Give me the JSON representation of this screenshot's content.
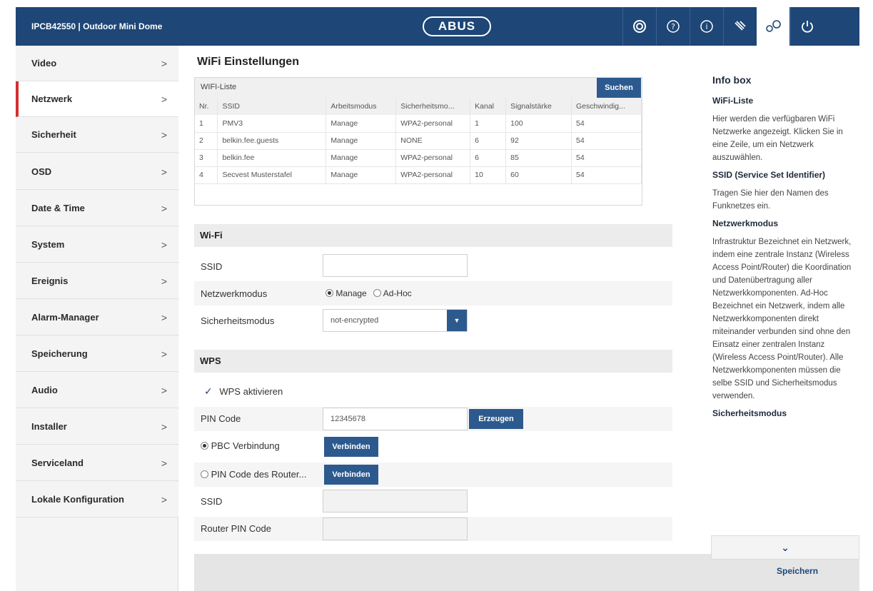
{
  "header": {
    "brand": "IPCB42550 | Outdoor Mini Dome",
    "logo": "ABUS",
    "icons": [
      "camera-icon",
      "help-icon",
      "info-icon",
      "tools-icon",
      "settings-icon",
      "power-icon"
    ],
    "active_icon": "settings-icon",
    "colors": {
      "bar": "#1e4676",
      "button": "#2d5a8e",
      "active_marker": "#d32f2f"
    }
  },
  "sidebar": {
    "items": [
      {
        "label": "Video",
        "chev": ">"
      },
      {
        "label": "Netzwerk",
        "chev": ">"
      },
      {
        "label": "Sicherheit",
        "chev": ">"
      },
      {
        "label": "OSD",
        "chev": ">"
      },
      {
        "label": "Date & Time",
        "chev": ">"
      },
      {
        "label": "System",
        "chev": ">"
      },
      {
        "label": "Ereignis",
        "chev": ">"
      },
      {
        "label": "Alarm-Manager",
        "chev": ">"
      },
      {
        "label": "Speicherung",
        "chev": ">"
      },
      {
        "label": "Audio",
        "chev": ">"
      },
      {
        "label": "Installer",
        "chev": ">"
      },
      {
        "label": "Serviceland",
        "chev": ">"
      },
      {
        "label": "Lokale Konfiguration",
        "chev": ">"
      }
    ],
    "active": "Netzwerk"
  },
  "main": {
    "title": "WiFi Einstellungen",
    "wifi_list": {
      "label": "WIFI-Liste",
      "search_button": "Suchen",
      "columns": [
        "Nr.",
        "SSID",
        "Arbeitsmodus",
        "Sicherheitsmo...",
        "Kanal",
        "Signalstärke",
        "Geschwindig..."
      ],
      "rows": [
        [
          "1",
          "PMV3",
          "Manage",
          "WPA2-personal",
          "1",
          "100",
          "54"
        ],
        [
          "2",
          "belkin.fee.guests",
          "Manage",
          "NONE",
          "6",
          "92",
          "54"
        ],
        [
          "3",
          "belkin.fee",
          "Manage",
          "WPA2-personal",
          "6",
          "85",
          "54"
        ],
        [
          "4",
          "Secvest Musterstafel",
          "Manage",
          "WPA2-personal",
          "10",
          "60",
          "54"
        ]
      ]
    },
    "wifi": {
      "section": "Wi-Fi",
      "ssid_label": "SSID",
      "ssid_value": "",
      "mode_label": "Netzwerkmodus",
      "mode_manage": "Manage",
      "mode_adhoc": "Ad-Hoc",
      "security_label": "Sicherheitsmodus",
      "security_value": "not-encrypted",
      "select_arrow": "▼"
    },
    "wps": {
      "section": "WPS",
      "enable_label": "WPS aktivieren",
      "checkmark": "✓",
      "pin_label": "PIN Code",
      "pin_value": "12345678",
      "generate_button": "Erzeugen",
      "pbc_label": "PBC Verbindung",
      "pbc_button": "Verbinden",
      "router_pin_label": "PIN Code des Router...",
      "router_button": "Verbinden",
      "ssid_label": "SSID",
      "router_pin_code_label": "Router PIN Code"
    }
  },
  "infobox": {
    "title": "Info box",
    "sections": [
      {
        "heading": "WiFi-Liste",
        "text": "Hier werden die verfügbaren WiFi Netzwerke angezeigt. Klicken Sie in eine Zeile, um ein Netzwerk auszuwählen."
      },
      {
        "heading": "SSID (Service Set Identifier)",
        "text": "Tragen Sie hier den Namen des Funknetzes ein."
      },
      {
        "heading": "Netzwerkmodus",
        "text": "Infrastruktur Bezeichnet ein Netzwerk, indem eine zentrale Instanz (Wireless Access Point/Router) die Koordination und Datenübertragung aller Netzwerkkomponenten. Ad-Hoc Bezeichnet ein Netzwerk, indem alle Netzwerkkomponenten direkt miteinander verbunden sind ohne den Einsatz einer zentralen Instanz (Wireless Access Point/Router). Alle Netzwerkkomponenten müssen die selbe SSID und Sicherheitsmodus verwenden."
      },
      {
        "heading": "Sicherheitsmodus",
        "text": ""
      }
    ],
    "more": "⌄",
    "save": "Speichern"
  }
}
